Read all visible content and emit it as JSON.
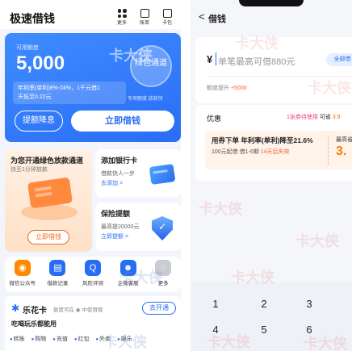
{
  "left": {
    "header": {
      "title": "极速借钱",
      "icons": [
        {
          "label": "更多",
          "icon": "more-icon"
        },
        {
          "label": "账单",
          "icon": "bill-icon"
        },
        {
          "label": "卡包",
          "icon": "wallet-icon"
        }
      ]
    },
    "card": {
      "available_label": "可用额度",
      "amount": "5,000",
      "rate_line1": "年利率(单利)8%-24%，1千元借1",
      "rate_line2": "天低至0.22元",
      "green_channel": "绿色通道",
      "quota_note": "专项额度  放款快",
      "raise_button": "提额降息",
      "borrow_button": "立即借钱"
    },
    "tile_green": {
      "title": "为您开通绿色放款通道",
      "subtitle": "快至1分钟放款",
      "button": "立即借钱"
    },
    "tile_bank": {
      "title": "添加银行卡",
      "subtitle": "借款快人一步",
      "action": "去添加 >"
    },
    "tile_insurance": {
      "title": "保险提额",
      "subtitle": "最高提20000元",
      "action": "立即提额 >"
    },
    "services": [
      {
        "label": "微信公众号",
        "glyph": "◉"
      },
      {
        "label": "借款记录",
        "glyph": "▤"
      },
      {
        "label": "风险评测",
        "glyph": "Q"
      },
      {
        "label": "企微客服",
        "glyph": "☻"
      },
      {
        "label": "更多",
        "glyph": "⁘"
      }
    ],
    "lehua": {
      "name": "乐花卡",
      "quota": "额度可在 ◉ 中使用哦",
      "open_button": "去开通",
      "slogan": "吃喝玩乐都能用",
      "categories": [
        "转账",
        "购物",
        "充值",
        "红包",
        "外卖",
        "娱乐"
      ]
    }
  },
  "right": {
    "header": {
      "back": "<",
      "title": "借钱"
    },
    "input": {
      "currency": "¥",
      "placeholder": "单笔最高可借880元",
      "borrow_all": "全部借",
      "raise_label": "额度提升",
      "raise_value": "+5000"
    },
    "coupon": {
      "title": "优惠",
      "available_text": "1张券待使用",
      "available_label": "可省",
      "available_value": "3.9",
      "line1": "用券下单 年利率(单利)降至21.6%",
      "line2_left": "100元起借 借1-6期 ",
      "line2_right": "14天后失效",
      "save_label": "最高省",
      "save_value": "3."
    },
    "keypad": [
      "1",
      "2",
      "3",
      "4",
      "5",
      "6"
    ]
  },
  "watermark": "卡大侠"
}
